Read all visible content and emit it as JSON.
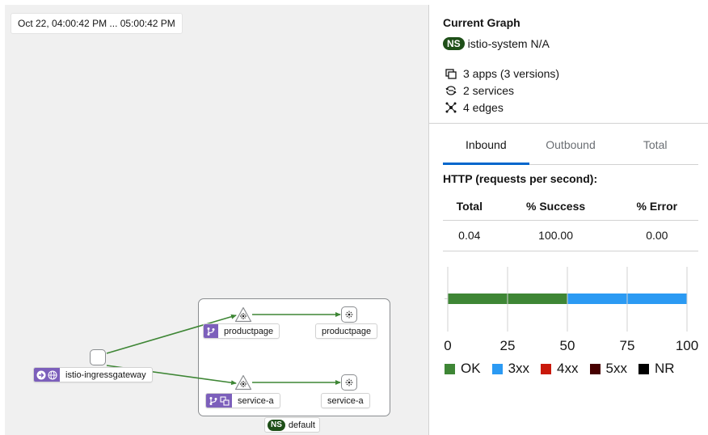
{
  "graph": {
    "time_range": "Oct 22, 04:00:42 PM ... 05:00:42 PM",
    "nodes": {
      "gateway": {
        "label": "istio-ingressgateway"
      },
      "productpage_app": {
        "label": "productpage"
      },
      "productpage_workload": {
        "label": "productpage"
      },
      "service_a_app": {
        "label": "service-a"
      },
      "service_a_workload": {
        "label": "service-a"
      }
    },
    "namespace_box": {
      "badge": "NS",
      "label": "default"
    }
  },
  "panel": {
    "title": "Current Graph",
    "namespace_badge": "NS",
    "namespace": "istio-system N/A",
    "stats": {
      "apps": "3 apps (3 versions)",
      "services": "2 services",
      "edges": "4 edges"
    },
    "tabs": [
      {
        "label": "Inbound",
        "active": true
      },
      {
        "label": "Outbound",
        "active": false
      },
      {
        "label": "Total",
        "active": false
      }
    ],
    "http_title": "HTTP (requests per second):",
    "table": {
      "headers": [
        "Total",
        "% Success",
        "% Error"
      ],
      "row": [
        "0.04",
        "100.00",
        "0.00"
      ]
    }
  },
  "chart_data": {
    "type": "bar",
    "orientation": "horizontal",
    "stacked": true,
    "categories": [
      ""
    ],
    "series": [
      {
        "name": "OK",
        "values": [
          50
        ],
        "color": "#3e8635"
      },
      {
        "name": "3xx",
        "values": [
          50
        ],
        "color": "#2b9af3"
      },
      {
        "name": "4xx",
        "values": [
          0
        ],
        "color": "#c9190b"
      },
      {
        "name": "5xx",
        "values": [
          0
        ],
        "color": "#470000"
      },
      {
        "name": "NR",
        "values": [
          0
        ],
        "color": "#000000"
      }
    ],
    "xlim": [
      0,
      100
    ],
    "xticks": [
      "0",
      "25",
      "50",
      "75",
      "100"
    ],
    "grid": true,
    "legend": "bottom"
  },
  "colors": {
    "edge": "#3e8635",
    "badge": "#7c5fbb",
    "namespace_badge": "#1e4f18",
    "tab_active": "#0066cc"
  }
}
